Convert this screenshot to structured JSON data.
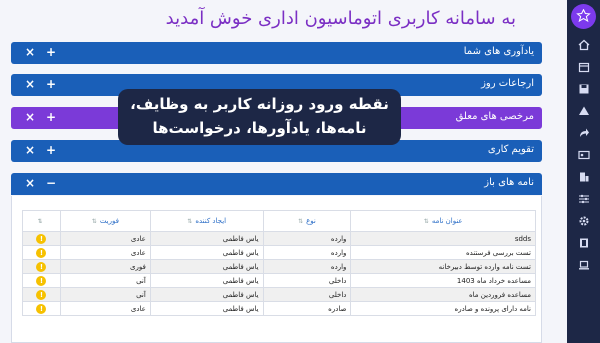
{
  "page": {
    "title": "به سامانه کاربری اتوماسیون اداری خوش آمدید"
  },
  "sidebar": {
    "items": [
      {
        "icon": "home-icon"
      },
      {
        "icon": "calendar-icon"
      },
      {
        "icon": "save-icon"
      },
      {
        "icon": "drive-icon"
      },
      {
        "icon": "forward-icon"
      },
      {
        "icon": "id-card-icon"
      },
      {
        "icon": "building-icon"
      },
      {
        "icon": "sliders-icon"
      },
      {
        "icon": "gear-icon"
      },
      {
        "icon": "film-icon"
      },
      {
        "icon": "laptop-icon"
      }
    ]
  },
  "panels": {
    "reminders": {
      "title": "یادآوری های شما"
    },
    "referrals": {
      "title": "ارجاعات روز"
    },
    "leaves": {
      "title": "مرخصی های معلق"
    },
    "calendar": {
      "title": "تقویم کاری"
    },
    "open_letters": {
      "title": "نامه های باز"
    }
  },
  "controls": {
    "close": "×",
    "expand": "+",
    "collapse": "−"
  },
  "tooltip": {
    "line1": "نقطه ورود روزانه کاربر به وظایف،",
    "line2": "نامه‌ها، یادآورها، درخواست‌ها"
  },
  "table": {
    "headers": [
      "عنوان نامه",
      "نوع",
      "ایجاد کننده",
      "فوریت"
    ],
    "sort_glyph": "⇅",
    "rows": [
      [
        "sdds",
        "وارده",
        "یاس فاطمی",
        "عادی"
      ],
      [
        "تست بررسی فرستنده",
        "وارده",
        "یاس فاطمی",
        "عادی"
      ],
      [
        "تست نامه وارده توسط دبیرخانه",
        "وارده",
        "یاس فاطمی",
        "فوری"
      ],
      [
        "مساعده خرداد ماه 1403",
        "داخلی",
        "یاس فاطمی",
        "آنی"
      ],
      [
        "مساعده فروردین ماه",
        "داخلی",
        "یاس فاطمی",
        "آنی"
      ],
      [
        "نامه دارای پرونده و صادره",
        "صادره",
        "یاس فاطمی",
        "عادی"
      ]
    ]
  },
  "colors": {
    "sidebar": "#1d2746",
    "panel_blue": "#1a5fb8",
    "panel_purple": "#7b3ad8",
    "title": "#7b2fc4",
    "warning": "#f6c100"
  }
}
